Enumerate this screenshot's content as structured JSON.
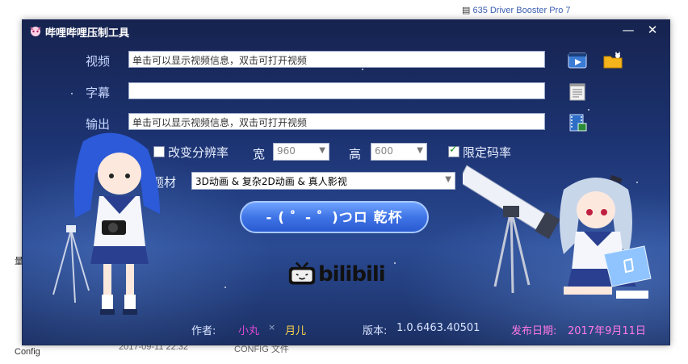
{
  "background": {
    "top_link": "635 Driver Booster Pro 7",
    "bottom_left": "Config",
    "bottom_date": "2017-09-11 22:32",
    "bottom_type": "CONFIG 文件",
    "side_char": "量"
  },
  "window": {
    "title": "哔哩哔哩压制工具",
    "minimize": "—",
    "close": "✕"
  },
  "form": {
    "video_label": "视频",
    "video_placeholder": "单击可以显示视频信息，双击可打开视频",
    "subtitle_label": "字幕",
    "subtitle_value": "",
    "output_label": "输出",
    "output_placeholder": "单击可以显示视频信息，双击可打开视频",
    "change_resolution_label": "改变分辨率",
    "width_label": "宽",
    "width_value": "960",
    "height_label": "高",
    "height_value": "600",
    "limit_bitrate_label": "限定码率",
    "limit_bitrate_checked": true,
    "change_resolution_checked": false,
    "genre_label": "题材",
    "genre_value": "3D动画 & 复杂2D动画 & 真人影视",
    "go_button": "- ( ゜- ゜)つロ 乾杯"
  },
  "logo_text": "bilibili",
  "footer": {
    "author_label": "作者:",
    "author1": "小丸",
    "separator": "×",
    "author2": "月儿",
    "version_label": "版本:",
    "version": "1.0.6463.40501",
    "release_label": "发布日期:",
    "release_date": "2017年9月11日"
  },
  "colors": {
    "author1": "#e04ad6",
    "author2": "#ffd84a",
    "version": "#d9e4ff",
    "release": "#ff79e6"
  }
}
